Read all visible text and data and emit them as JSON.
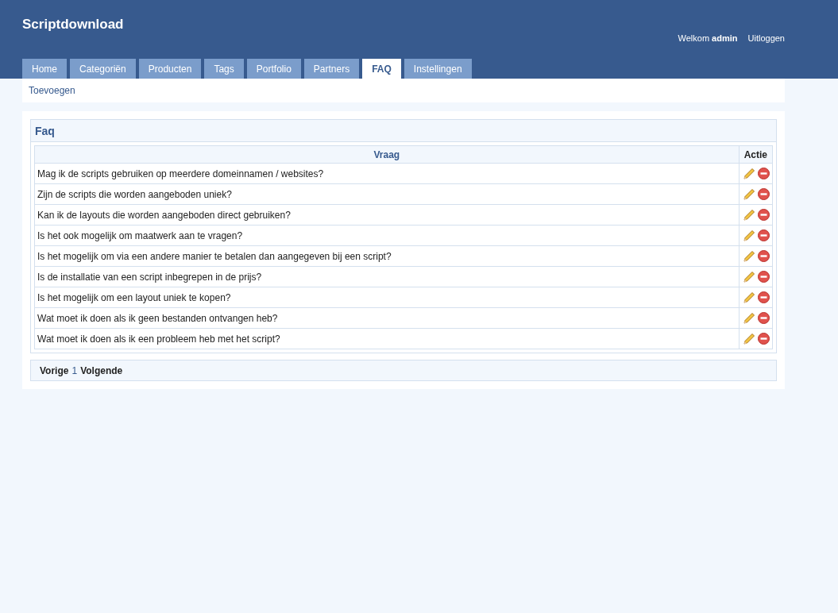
{
  "site_title": "Scriptdownload",
  "user": {
    "greeting": "Welkom",
    "name": "admin",
    "logout": "Uitloggen"
  },
  "tabs": [
    {
      "label": "Home",
      "selected": false
    },
    {
      "label": "Categoriën",
      "selected": false
    },
    {
      "label": "Producten",
      "selected": false
    },
    {
      "label": "Tags",
      "selected": false
    },
    {
      "label": "Portfolio",
      "selected": false
    },
    {
      "label": "Partners",
      "selected": false
    },
    {
      "label": "FAQ",
      "selected": true
    },
    {
      "label": "Instellingen",
      "selected": false
    }
  ],
  "subnav": [
    "Toevoegen"
  ],
  "panel": {
    "title": "Faq",
    "table": {
      "columns": [
        "Vraag",
        "Actie"
      ],
      "rows": [
        {
          "vraag": "Mag ik de scripts gebruiken op meerdere domeinnamen / websites?"
        },
        {
          "vraag": "Zijn de scripts die worden aangeboden uniek?"
        },
        {
          "vraag": "Kan ik de layouts die worden aangeboden direct gebruiken?"
        },
        {
          "vraag": "Is het ook mogelijk om maatwerk aan te vragen?"
        },
        {
          "vraag": "Is het mogelijk om via een andere manier te betalen dan aangegeven bij een script?"
        },
        {
          "vraag": "Is de installatie van een script inbegrepen in de prijs?"
        },
        {
          "vraag": "Is het mogelijk om een layout uniek te kopen?"
        },
        {
          "vraag": "Wat moet ik doen als ik geen bestanden ontvangen heb?"
        },
        {
          "vraag": "Wat moet ik doen als ik een probleem heb met het script?"
        }
      ]
    },
    "pagination": {
      "previous": "Vorige",
      "pages": [
        "1"
      ],
      "next": "Volgende"
    }
  }
}
